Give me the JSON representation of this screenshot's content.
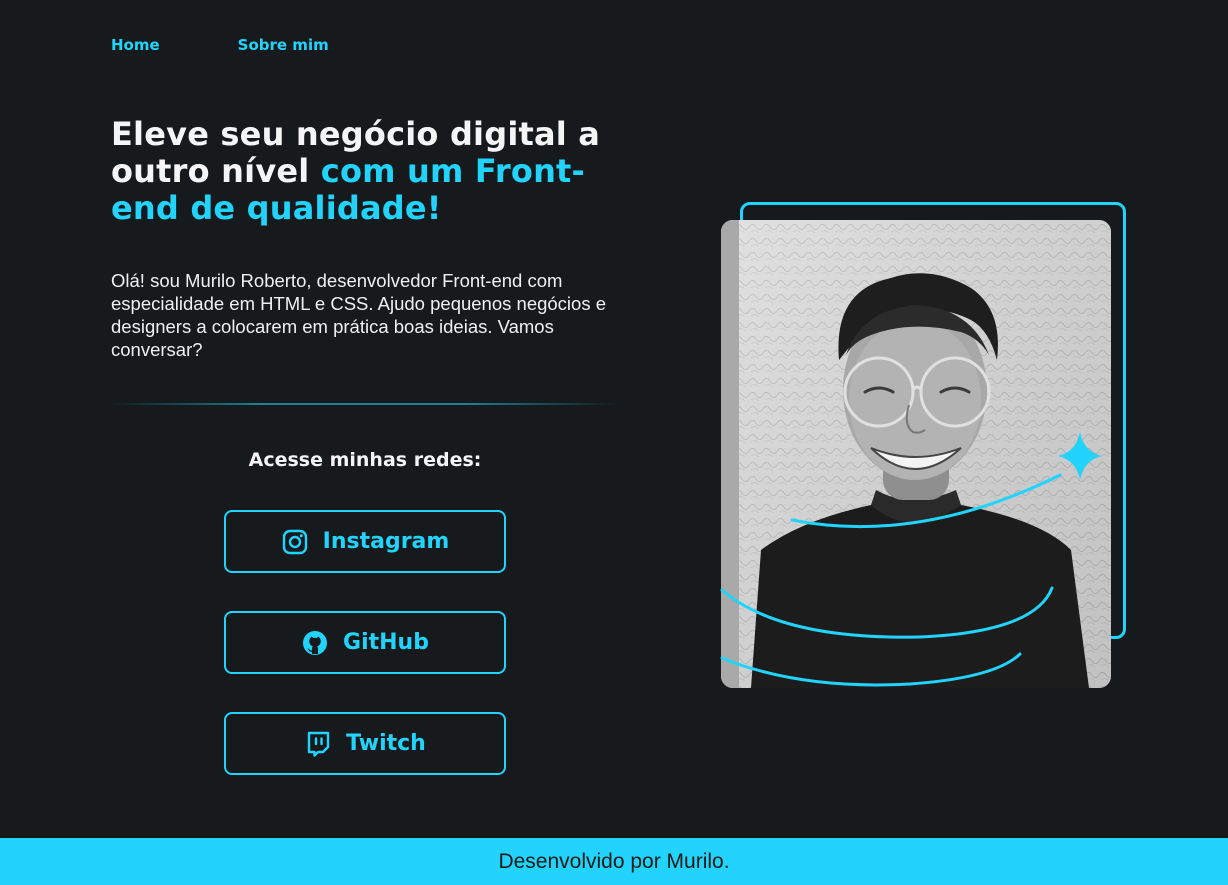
{
  "nav": {
    "home": "Home",
    "about": "Sobre mim"
  },
  "hero": {
    "headline_plain": "Eleve seu negócio digital a outro nível ",
    "headline_accent": "com um Front-end de qualidade!",
    "intro": "Olá! sou Murilo Roberto, desenvolvedor Front-end com especialidade em HTML e CSS. Ajudo pequenos negócios e designers a colocarem em prática boas ideias. Vamos conversar?"
  },
  "social": {
    "title": "Acesse minhas redes:",
    "buttons": [
      {
        "label": "Instagram",
        "icon": "instagram-icon"
      },
      {
        "label": "GitHub",
        "icon": "github-icon"
      },
      {
        "label": "Twitch",
        "icon": "twitch-icon"
      }
    ]
  },
  "footer": {
    "text": "Desenvolvido por Murilo."
  },
  "colors": {
    "accent": "#22d4fd",
    "background": "#161a1d",
    "text": "#f5f5f5"
  }
}
